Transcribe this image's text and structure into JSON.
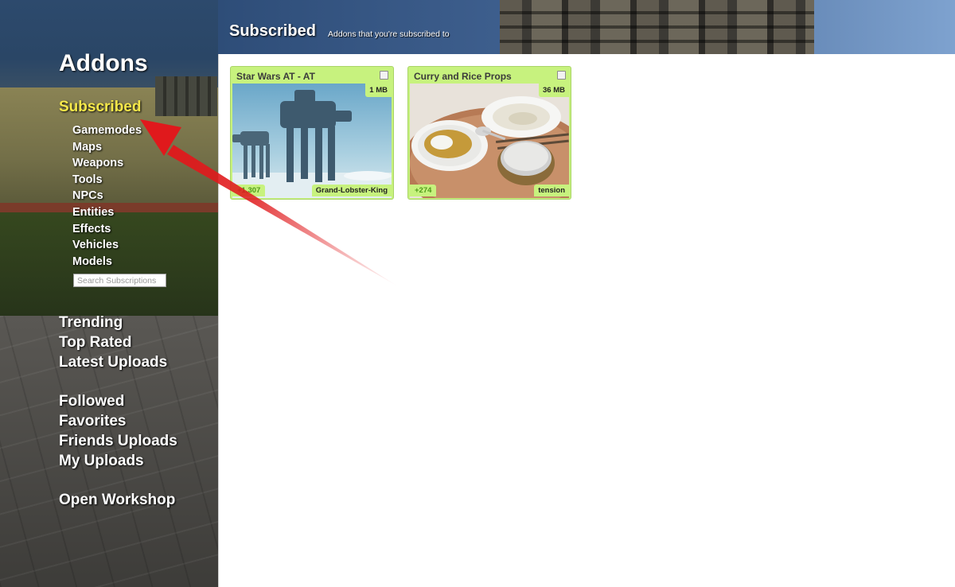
{
  "sidebar": {
    "title": "Addons",
    "subscribed_label": "Subscribed",
    "categories": [
      "Gamemodes",
      "Maps",
      "Weapons",
      "Tools",
      "NPCs",
      "Entities",
      "Effects",
      "Vehicles",
      "Models"
    ],
    "search_placeholder": "Search Subscriptions",
    "browse": [
      "Trending",
      "Top Rated",
      "Latest Uploads"
    ],
    "social": [
      "Followed",
      "Favorites",
      "Friends Uploads",
      "My Uploads"
    ],
    "workshop": "Open Workshop"
  },
  "header": {
    "title": "Subscribed",
    "subtitle": "Addons that you're subscribed to"
  },
  "addons": [
    {
      "title": "Star Wars AT - AT",
      "size": "1 MB",
      "votes": "+1,307",
      "author": "Grand-Lobster-King"
    },
    {
      "title": "Curry and Rice Props",
      "size": "36 MB",
      "votes": "+274",
      "author": "tension"
    }
  ],
  "colors": {
    "accent_subscribed": "#f6e84a",
    "card_green": "#c7f27e",
    "votes_green": "#4f9a1a",
    "annotation_arrow": "#e0191c"
  },
  "icons": {
    "card_checkbox": "checkbox-icon",
    "annotation": "red-arrow-icon"
  }
}
